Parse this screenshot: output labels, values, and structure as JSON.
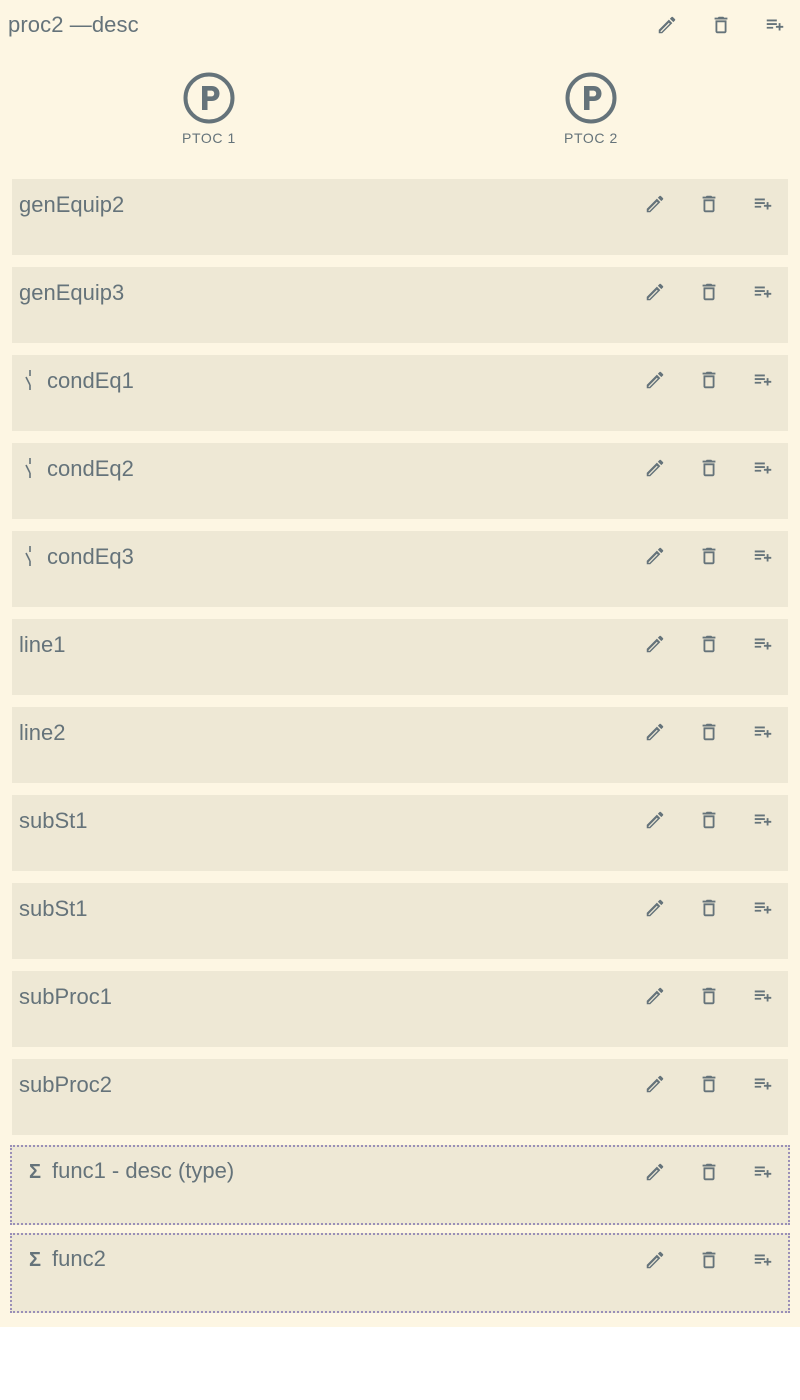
{
  "header": {
    "title": "proc2 —desc",
    "icons": [
      "edit-icon",
      "delete-icon",
      "playlist-add-icon"
    ]
  },
  "lnodes": [
    {
      "label": "PTOC 1",
      "icon": "letter-p-circle-icon"
    },
    {
      "label": "PTOC 2",
      "icon": "letter-p-circle-icon"
    }
  ],
  "cards": [
    {
      "title": "genEquip2",
      "icon": ""
    },
    {
      "title": "genEquip3",
      "icon": ""
    },
    {
      "title": "condEq1",
      "icon": "switch-icon"
    },
    {
      "title": "condEq2",
      "icon": "switch-icon"
    },
    {
      "title": "condEq3",
      "icon": "switch-icon"
    },
    {
      "title": "line1",
      "icon": ""
    },
    {
      "title": "line2",
      "icon": ""
    },
    {
      "title": "subSt1",
      "icon": ""
    },
    {
      "title": "subSt1",
      "icon": ""
    },
    {
      "title": "subProc1",
      "icon": ""
    },
    {
      "title": "subProc2",
      "icon": ""
    },
    {
      "title": "func1 - desc (type)",
      "icon": "sigma-icon",
      "glyph": "Σ"
    },
    {
      "title": "func2",
      "icon": "sigma-icon",
      "glyph": "Σ"
    }
  ],
  "colors": {
    "panel": "#fdf6e3",
    "card": "#eee8d5",
    "text": "#65737a",
    "dotted_border": "#9a8fb7"
  }
}
